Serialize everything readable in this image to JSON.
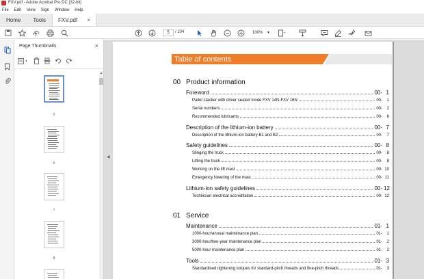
{
  "window": {
    "title": "FXV.pdf - Adobe Acrobat Pro DC (32-bit)"
  },
  "menu": [
    "File",
    "Edit",
    "View",
    "Sign",
    "Window",
    "Help"
  ],
  "tabs": {
    "home": "Home",
    "tools": "Tools",
    "doc": "FXV.pdf",
    "close": "×"
  },
  "toolbar": {
    "page_current": "5",
    "page_total": "/ 204",
    "zoom": "100%"
  },
  "panel": {
    "title": "Page Thumbnails",
    "close": "×",
    "thumbnails": [
      {
        "label": "5",
        "selected": true
      },
      {
        "label": "6",
        "selected": false
      },
      {
        "label": "7",
        "selected": false
      },
      {
        "label": "8",
        "selected": false
      }
    ]
  },
  "colors": {
    "accent_orange": "#f07c28",
    "selected_thumb": "#6a8fc9"
  },
  "document": {
    "toc_title": "Table of contents",
    "sections": [
      {
        "num": "00",
        "title": "Product information",
        "entries": [
          {
            "text": "Foreword",
            "level": 1,
            "chap": "00-",
            "page": "1"
          },
          {
            "text": "Pallet stacker with driver seated mode FXV 14N-FXV 16N",
            "level": 2,
            "chap": "00-",
            "page": "1"
          },
          {
            "text": "Serial numbers",
            "level": 2,
            "chap": "00-",
            "page": "2"
          },
          {
            "text": "Recommended lubricants",
            "level": 2,
            "chap": "00-",
            "page": "6"
          },
          {
            "text": "Description of the lithium-ion battery",
            "level": 1,
            "chap": "00-",
            "page": "7"
          },
          {
            "text": "Description of the lithium-ion battery B1 and B2",
            "level": 2,
            "chap": "00-",
            "page": "7"
          },
          {
            "text": "Safety guidelines",
            "level": 1,
            "chap": "00-",
            "page": "8"
          },
          {
            "text": "Slinging the truck",
            "level": 2,
            "chap": "00-",
            "page": "8"
          },
          {
            "text": "Lifting the truck",
            "level": 2,
            "chap": "00-",
            "page": "8"
          },
          {
            "text": "Working on the lift mast",
            "level": 2,
            "chap": "00-",
            "page": "10"
          },
          {
            "text": "Emergency lowering of the mast",
            "level": 2,
            "chap": "00-",
            "page": "11"
          },
          {
            "text": "Lithium-ion safety guidelines",
            "level": 1,
            "chap": "00-",
            "page": "12"
          },
          {
            "text": "Technician electrical accreditation",
            "level": 2,
            "chap": "00-",
            "page": "12"
          }
        ]
      },
      {
        "num": "01",
        "title": "Service",
        "entries": [
          {
            "text": "Maintenance",
            "level": 1,
            "chap": "01-",
            "page": "1"
          },
          {
            "text": "1000-hour/annual maintenance plan",
            "level": 2,
            "chap": "01-",
            "page": "1"
          },
          {
            "text": "3000-hour/two-year maintenance plan",
            "level": 2,
            "chap": "01-",
            "page": "2"
          },
          {
            "text": "5000-hour maintenance plan",
            "level": 2,
            "chap": "01-",
            "page": "2"
          },
          {
            "text": "Tools",
            "level": 1,
            "chap": "01-",
            "page": "3"
          },
          {
            "text": "Standardised tightening torques for standard-pitch threads and fine-pitch threads",
            "level": 2,
            "chap": "01-",
            "page": "3"
          }
        ]
      }
    ]
  }
}
